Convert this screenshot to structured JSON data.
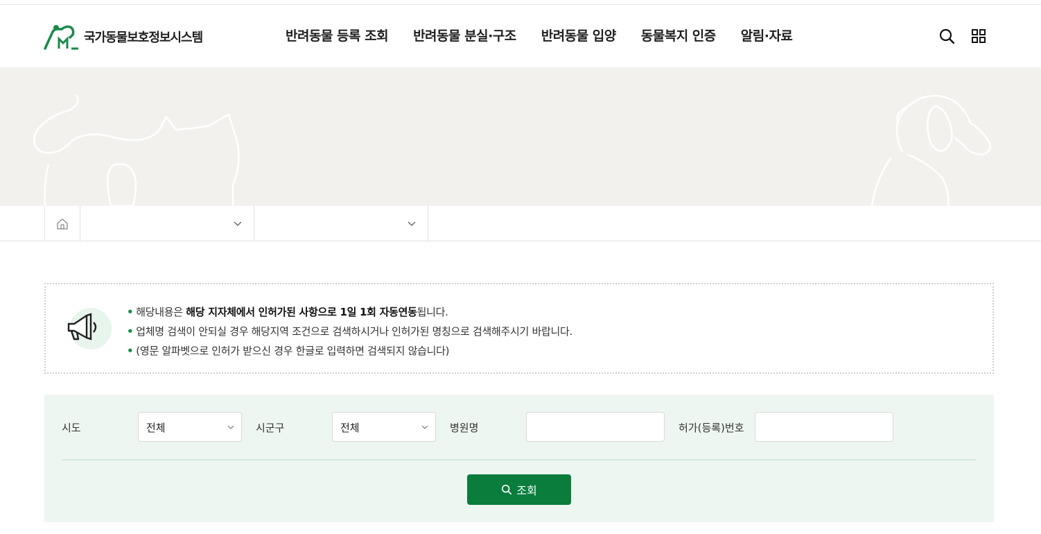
{
  "header": {
    "logo_text": "국가동물보호정보시스템",
    "nav": [
      {
        "label": "반려동물 등록 조회"
      },
      {
        "label": "반려동물 분실·구조"
      },
      {
        "label": "반려동물 입양"
      },
      {
        "label": "동물복지 인증"
      },
      {
        "label": "알림·자료"
      }
    ],
    "icons": [
      "search-icon",
      "menu-grid-icon"
    ]
  },
  "breadcrumb": {
    "home_icon": "home-icon",
    "dropdown1": "",
    "dropdown2": ""
  },
  "notice": {
    "icon": "megaphone-icon",
    "line1_prefix": "해당내용은 ",
    "line1_bold": "해당 지자체에서 인허가된 사항으로 1일 1회 자동연동",
    "line1_suffix": "됩니다.",
    "line2": "업체명 검색이 안되실 경우 해당지역 조건으로 검색하시거나 인허가된 명칭으로 검색해주시기 바랍니다.",
    "line3": "(영문 알파벳으로 인허가 받으신 경우 한글로 입력하면 검색되지 않습니다)"
  },
  "search": {
    "sido_label": "시도",
    "sido_value": "전체",
    "sigungu_label": "시군구",
    "sigungu_value": "전체",
    "hospital_label": "병원명",
    "hospital_value": "",
    "license_label": "허가(등록)번호",
    "license_value": "",
    "button_label": "조회"
  },
  "colors": {
    "brand_green": "#0a7d3d",
    "search_bg": "#eef6f1",
    "banner_bg": "#f2f1ee"
  }
}
